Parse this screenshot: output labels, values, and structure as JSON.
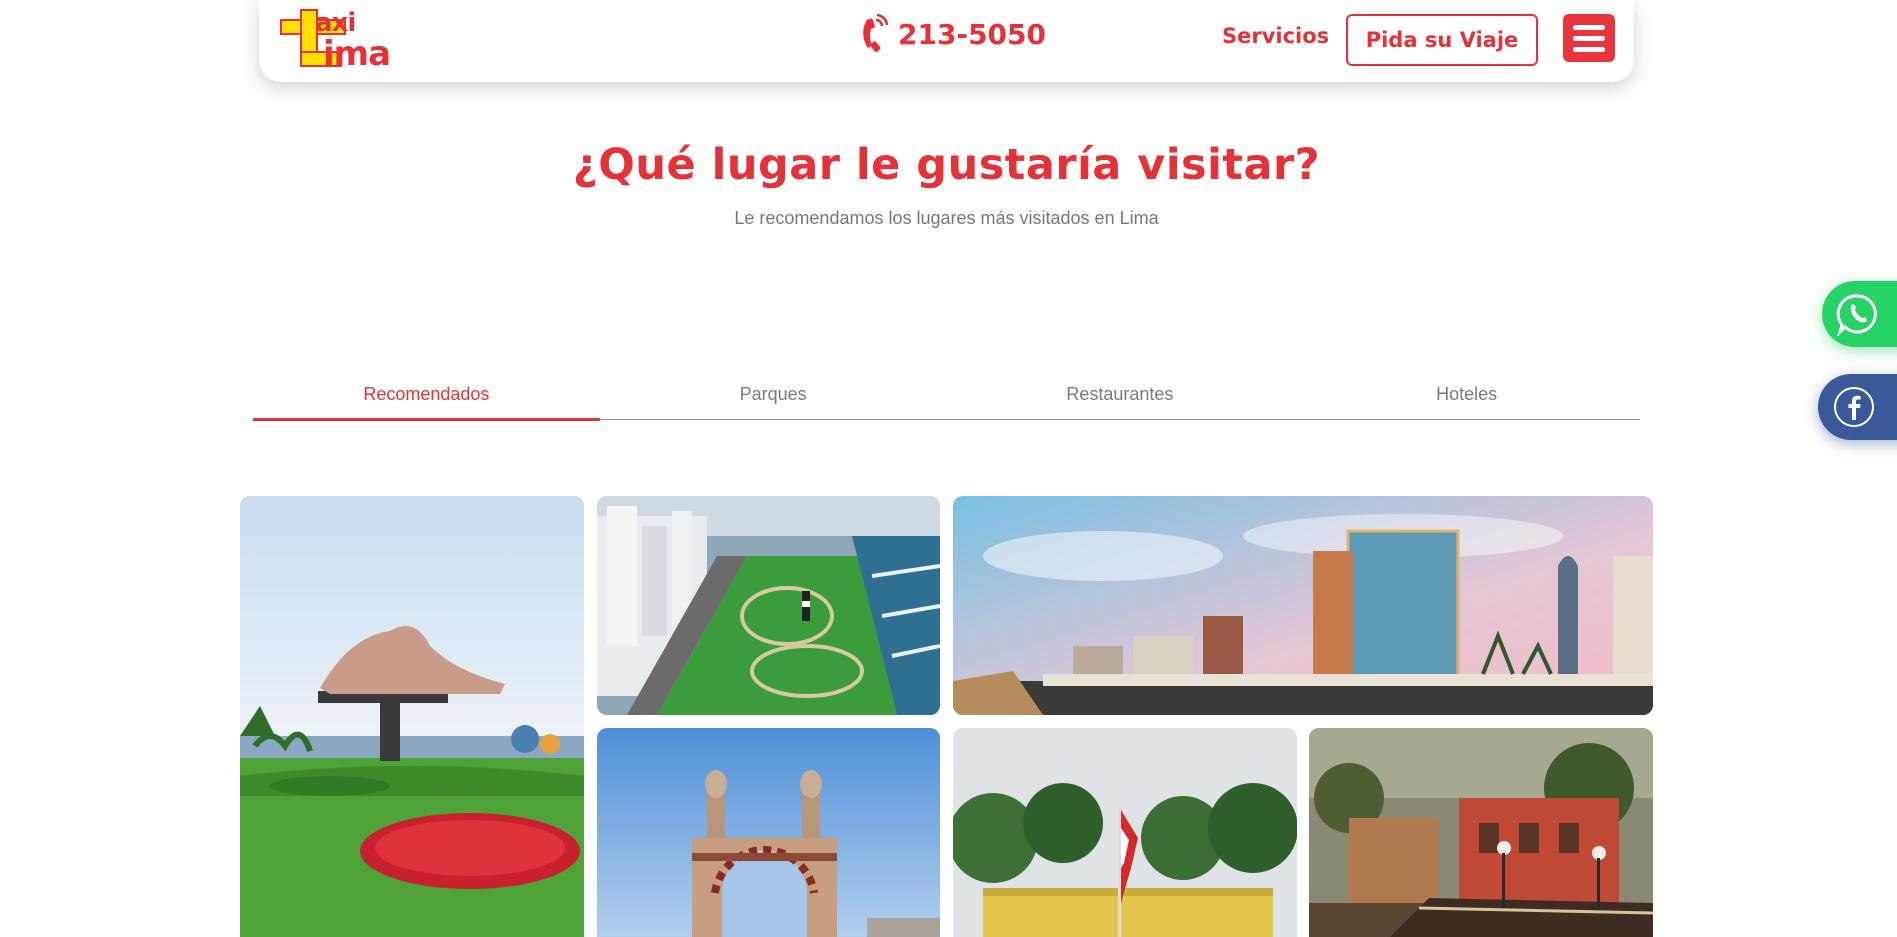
{
  "header": {
    "logo": {
      "line1": "axi",
      "line2": "ima",
      "initials": "TL"
    },
    "phone_number": "213-5050",
    "nav_servicios": "Servicios",
    "cta_label": "Pida su Viaje",
    "menu_icon": "hamburger-menu-icon"
  },
  "section": {
    "title": "¿Qué lugar le gustaría visitar?",
    "subtitle": "Le recomendamos los lugares más visitados en Lima"
  },
  "tabs": [
    {
      "label": "Recomendados",
      "active": true
    },
    {
      "label": "Parques",
      "active": false
    },
    {
      "label": "Restaurantes",
      "active": false
    },
    {
      "label": "Hoteles",
      "active": false
    }
  ],
  "floating": {
    "whatsapp_icon": "whatsapp-icon",
    "facebook_icon": "facebook-icon"
  },
  "gallery": [
    {
      "name": "parque-del-amor-photo"
    },
    {
      "name": "miraflores-aerial-park-photo"
    },
    {
      "name": "miraflores-skyline-photo"
    },
    {
      "name": "church-arch-photo"
    },
    {
      "name": "plaza-flag-photo"
    },
    {
      "name": "barranco-bridge-photo"
    }
  ],
  "colors": {
    "brand_red": "#e53238",
    "whatsapp_green": "#25d366",
    "facebook_blue": "#3b5998"
  }
}
